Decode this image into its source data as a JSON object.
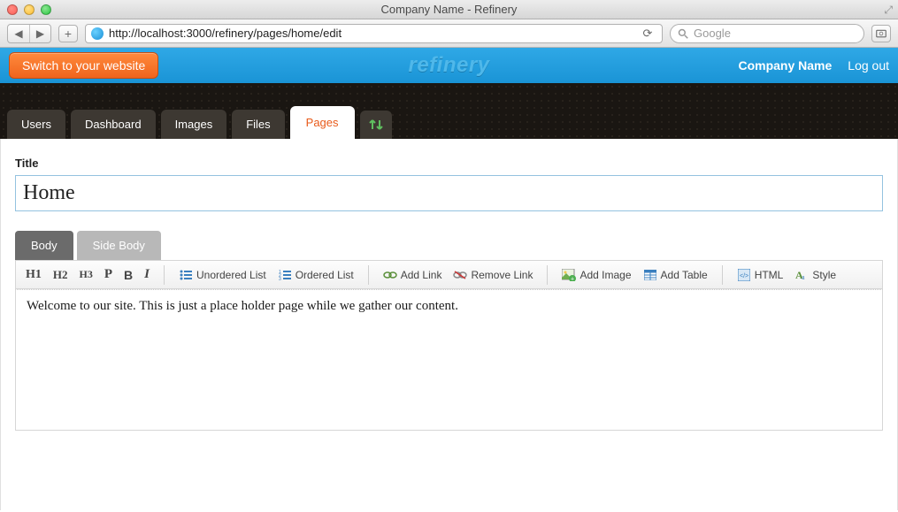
{
  "window": {
    "title": "Company Name - Refinery"
  },
  "browser": {
    "url": "http://localhost:3000/refinery/pages/home/edit",
    "search_placeholder": "Google"
  },
  "topbar": {
    "switch_label": "Switch to your website",
    "logo_text": "refinery",
    "company": "Company Name",
    "logout": "Log out"
  },
  "tabs": [
    {
      "label": "Users"
    },
    {
      "label": "Dashboard"
    },
    {
      "label": "Images"
    },
    {
      "label": "Files"
    },
    {
      "label": "Pages"
    }
  ],
  "page_form": {
    "title_label": "Title",
    "title_value": "Home"
  },
  "body_tabs": {
    "body": "Body",
    "side_body": "Side Body"
  },
  "editor_toolbar": {
    "h1": "H1",
    "h2": "H2",
    "h3": "H3",
    "p": "P",
    "bold": "B",
    "italic": "I",
    "ul": "Unordered List",
    "ol": "Ordered List",
    "add_link": "Add Link",
    "remove_link": "Remove Link",
    "add_image": "Add Image",
    "add_table": "Add Table",
    "html": "HTML",
    "style": "Style"
  },
  "editor_content": "Welcome to our site. This is just a place holder page while we gather our content."
}
